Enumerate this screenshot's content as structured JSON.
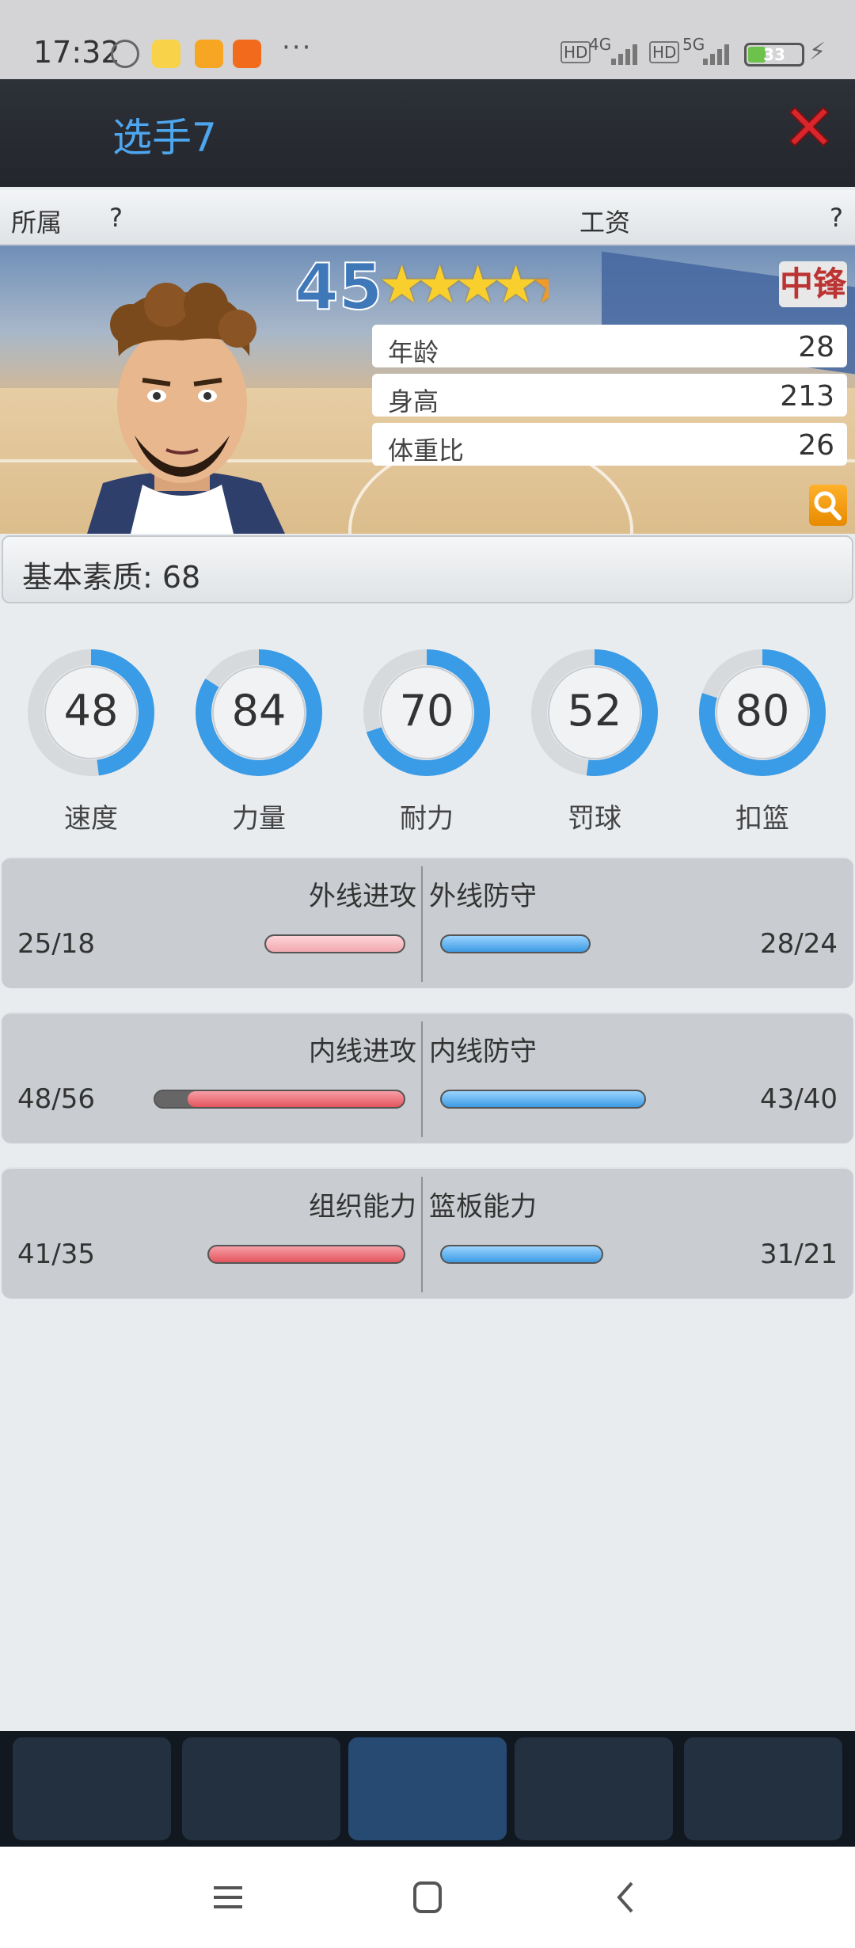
{
  "status_bar": {
    "time": "17:32",
    "icons": [
      "alarm-icon",
      "bunny-app-icon",
      "note-app-icon",
      "mi-app-icon"
    ],
    "more": "···",
    "sim1_label": "HD",
    "sim1_net": "4G",
    "sim2_label": "HD",
    "sim2_net": "5G",
    "battery": "33",
    "battery_level": 0.33
  },
  "header": {
    "title": "选手7",
    "close_icon": "close-icon"
  },
  "subbar": {
    "team_label": "所属",
    "team_value": "?",
    "salary_label": "工资",
    "salary_value": "?"
  },
  "player": {
    "overall": "45",
    "stars": 4.5,
    "position": "中锋",
    "info": [
      {
        "label": "年龄",
        "value": "28"
      },
      {
        "label": "身高",
        "value": "213"
      },
      {
        "label": "体重比",
        "value": "26"
      }
    ]
  },
  "base_quality": "基本素质: 68",
  "stats": [
    {
      "label": "速度",
      "value": "48",
      "level": 0.48
    },
    {
      "label": "力量",
      "value": "84",
      "level": 0.84
    },
    {
      "label": "耐力",
      "value": "70",
      "level": 0.7
    },
    {
      "label": "罚球",
      "value": "52",
      "level": 0.52
    },
    {
      "label": "扣篮",
      "value": "80",
      "level": 0.8
    }
  ],
  "skills": [
    {
      "left_label": "外线进攻",
      "left_value": "25/18",
      "right_label": "外线防守",
      "right_value": "28/24"
    },
    {
      "left_label": "内线进攻",
      "left_value": "48/56",
      "right_label": "内线防守",
      "right_value": "43/40"
    },
    {
      "left_label": "组织能力",
      "left_value": "41/35",
      "right_label": "篮板能力",
      "right_value": "31/21"
    }
  ],
  "colors": {
    "accent_blue": "#4ea6ee",
    "ring_blue": "#3a9be6",
    "attack_red": "#e4555d",
    "defense_blue": "#3c9be4",
    "close_red": "#d9262c"
  },
  "system_nav": [
    "menu-icon",
    "home-icon",
    "back-icon"
  ]
}
